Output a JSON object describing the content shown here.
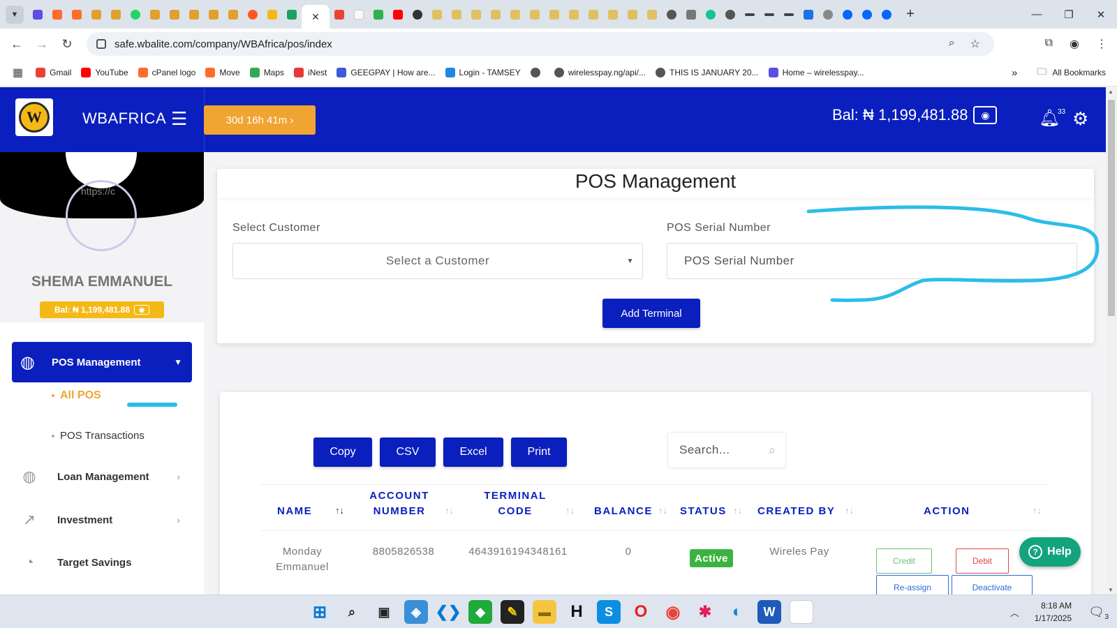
{
  "browser": {
    "url": "safe.wbalite.com/company/WBAfrica/pos/index",
    "active_tab_close": "✕",
    "new_tab": "+",
    "bookmarks": [
      {
        "label": "Gmail",
        "color": "#ea4335"
      },
      {
        "label": "YouTube",
        "color": "#ff0000"
      },
      {
        "label": "cPanel logo",
        "color": "#ff6c2c"
      },
      {
        "label": "Move",
        "color": "#ff6c2c"
      },
      {
        "label": "Maps",
        "color": "#34a853"
      },
      {
        "label": "iNest",
        "color": "#e53935"
      },
      {
        "label": "GEEGPAY | How are...",
        "color": "#3b5bdb"
      },
      {
        "label": "Login - TAMSEY",
        "color": "#1e88e5"
      },
      {
        "label": "",
        "color": "#555555"
      },
      {
        "label": "wirelesspay.ng/api/...",
        "color": "#555555"
      },
      {
        "label": "THIS IS JANUARY 20...",
        "color": "#555555"
      },
      {
        "label": "Home – wirelesspay...",
        "color": "#5c4ee5"
      }
    ],
    "more_bookmarks": "»",
    "all_bookmarks": "All Bookmarks"
  },
  "header": {
    "brand": "WBAFRICA",
    "logo_letter": "W",
    "timer": "30d 16h 41m ›",
    "balance": "Bal: ₦ 1,199,481.88",
    "notification_count": "33"
  },
  "sidebar": {
    "avatar_alt": "https://c",
    "user_name": "SHEMA EMMANUEL",
    "balance": "Bal: ₦ 1,199,481.88",
    "active_menu": "POS Management",
    "submenu": [
      "All POS",
      "POS Transactions"
    ],
    "menu": [
      "Loan Management",
      "Investment",
      "Target Savings"
    ]
  },
  "form": {
    "title": "POS Management",
    "customer_label": "Select Customer",
    "customer_placeholder": "Select a Customer",
    "serial_label": "POS Serial Number",
    "serial_placeholder": "POS Serial Number",
    "add_button": "Add Terminal"
  },
  "table": {
    "export_buttons": [
      "Copy",
      "CSV",
      "Excel",
      "Print"
    ],
    "search_placeholder": "Search...",
    "headers": {
      "name": "NAME",
      "account_1": "ACCOUNT",
      "account_2": "NUMBER",
      "terminal_1": "TERMINAL",
      "terminal_2": "CODE",
      "balance": "BALANCE",
      "status": "STATUS",
      "created_by": "CREATED BY",
      "action": "ACTION"
    },
    "rows": [
      {
        "name_1": "Monday",
        "name_2": "Emmanuel",
        "account_number": "8805826538",
        "terminal_code": "4643916194348161",
        "balance": "0",
        "status": "Active",
        "created_by": "Wireles Pay",
        "actions": [
          "Credit",
          "Debit",
          "Re-assign",
          "Deactivate"
        ]
      }
    ]
  },
  "help_button": "Help",
  "taskbar": {
    "time": "8:18 AM",
    "date": "1/17/2025",
    "notifications": "3"
  },
  "colors": {
    "primary": "#0a1fbd",
    "accent": "#f0a431",
    "status_active": "#3cb341",
    "help": "#14a37f",
    "annotation": "#2bbde9"
  }
}
